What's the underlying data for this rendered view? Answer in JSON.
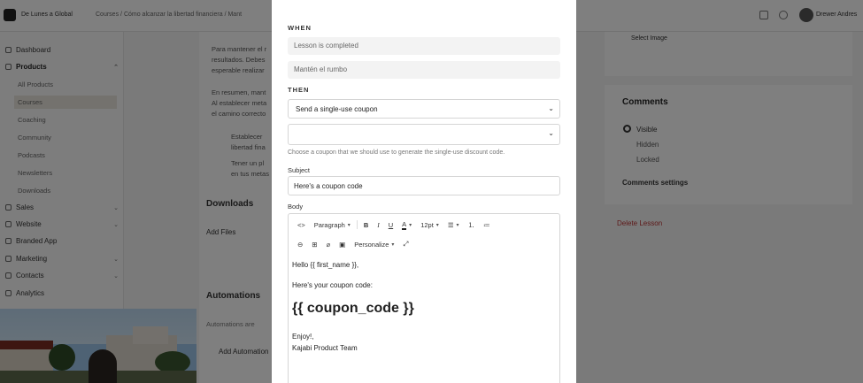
{
  "background": {
    "brand": "De Lunes a Global",
    "breadcrumb": [
      "Courses",
      "/",
      "Cómo alcanzar la libertad financiera",
      "/",
      "Mant"
    ],
    "user_name": "Drewer Andres",
    "sidebar": {
      "items": [
        {
          "label": "Dashboard",
          "kind": "top"
        },
        {
          "label": "Products",
          "kind": "top-bold"
        },
        {
          "label": "All Products",
          "kind": "sub"
        },
        {
          "label": "Courses",
          "kind": "sub-active"
        },
        {
          "label": "Coaching",
          "kind": "sub"
        },
        {
          "label": "Community",
          "kind": "sub"
        },
        {
          "label": "Podcasts",
          "kind": "sub"
        },
        {
          "label": "Newsletters",
          "kind": "sub"
        },
        {
          "label": "Downloads",
          "kind": "sub"
        },
        {
          "label": "Sales",
          "kind": "top"
        },
        {
          "label": "Website",
          "kind": "top"
        },
        {
          "label": "Branded App",
          "kind": "top"
        },
        {
          "label": "Marketing",
          "kind": "top"
        },
        {
          "label": "Contacts",
          "kind": "top"
        },
        {
          "label": "Analytics",
          "kind": "top"
        }
      ]
    },
    "content": {
      "para_lines": [
        "Para mantener el r",
        "resultados. Debes",
        "esperable realizar",
        "En resumen, mant",
        "Al establecer meta",
        "el camino correcto",
        "Establecer",
        "libertad fina",
        "Tener un pl",
        "en tus metas"
      ],
      "downloads_title": "Downloads",
      "add_files": "Add Files",
      "automations_title": "Automations",
      "automations_text": "Automations are",
      "add_automation": "Add Automation"
    },
    "right": {
      "select_image": "Select Image",
      "comments_title": "Comments",
      "comment_options": [
        "Visible",
        "Hidden",
        "Locked"
      ],
      "comments_settings": "Comments settings",
      "delete_lesson": "Delete Lesson"
    }
  },
  "modal": {
    "when_label": "WHEN",
    "when_trigger": "Lesson is completed",
    "when_target": "Mantén el rumbo",
    "then_label": "THEN",
    "action_select": "Send a single-use coupon",
    "coupon_select": "",
    "coupon_help": "Choose a coupon that we should use to generate the single-use discount code.",
    "subject_label": "Subject",
    "subject_value": "Here's a coupon code",
    "body_label": "Body",
    "toolbar": {
      "code": "<>",
      "paragraph": "Paragraph",
      "bold": "B",
      "italic": "I",
      "underline": "U",
      "color": "A",
      "font_size": "12pt",
      "personalize": "Personalize"
    },
    "body_lines": {
      "greeting": "Hello {{ first_name }},",
      "intro": "Here's your coupon code:",
      "code": "{{ coupon_code }}",
      "enjoy": "Enjoy!,",
      "signature": "Kajabi Product Team"
    }
  }
}
